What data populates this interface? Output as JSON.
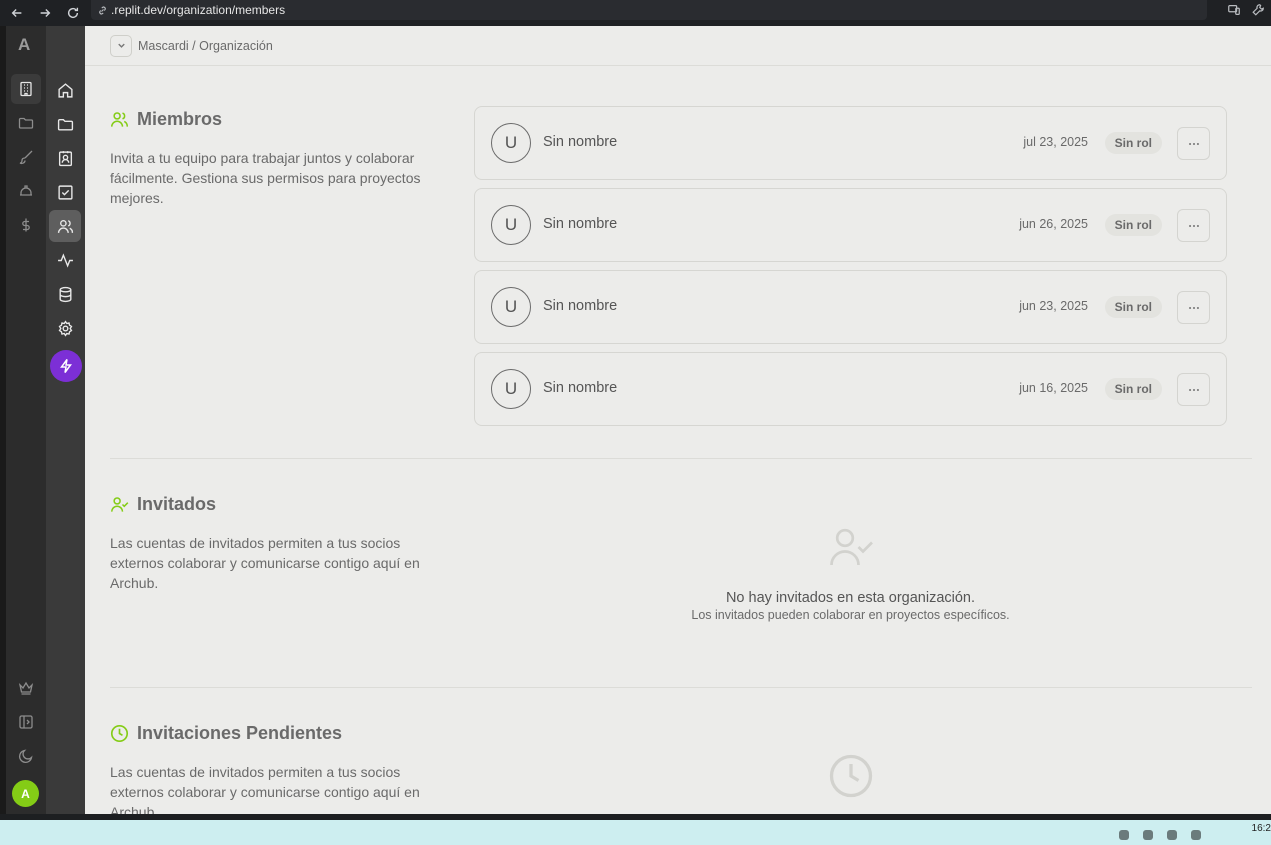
{
  "browser": {
    "url": ".replit.dev/organization/members"
  },
  "rail": {
    "logo": "A",
    "avatar_initial": "A"
  },
  "breadcrumb": "Mascardi / Organización",
  "members_section": {
    "title": "Miembros",
    "description": "Invita a tu equipo para trabajar juntos y colaborar fácilmente. Gestiona sus permisos para proyectos mejores.",
    "members": [
      {
        "initial": "U",
        "name": "Sin nombre",
        "date": "jul 23, 2025",
        "role": "Sin rol"
      },
      {
        "initial": "U",
        "name": "Sin nombre",
        "date": "jun 26, 2025",
        "role": "Sin rol"
      },
      {
        "initial": "U",
        "name": "Sin nombre",
        "date": "jun 23, 2025",
        "role": "Sin rol"
      },
      {
        "initial": "U",
        "name": "Sin nombre",
        "date": "jun 16, 2025",
        "role": "Sin rol"
      }
    ]
  },
  "guests_section": {
    "title": "Invitados",
    "description": "Las cuentas de invitados permiten a tus socios externos colaborar y comunicarse contigo aquí en Archub.",
    "empty_title": "No hay invitados en esta organización.",
    "empty_subtitle": "Los invitados pueden colaborar en proyectos específicos."
  },
  "pending_section": {
    "title": "Invitaciones Pendientes",
    "description": "Las cuentas de invitados permiten a tus socios externos colaborar y comunicarse contigo aquí en Archub."
  },
  "taskbar": {
    "clock": "16:2"
  },
  "colors": {
    "accent_green": "#84cc16",
    "bolt_purple": "#7c2fd6"
  }
}
